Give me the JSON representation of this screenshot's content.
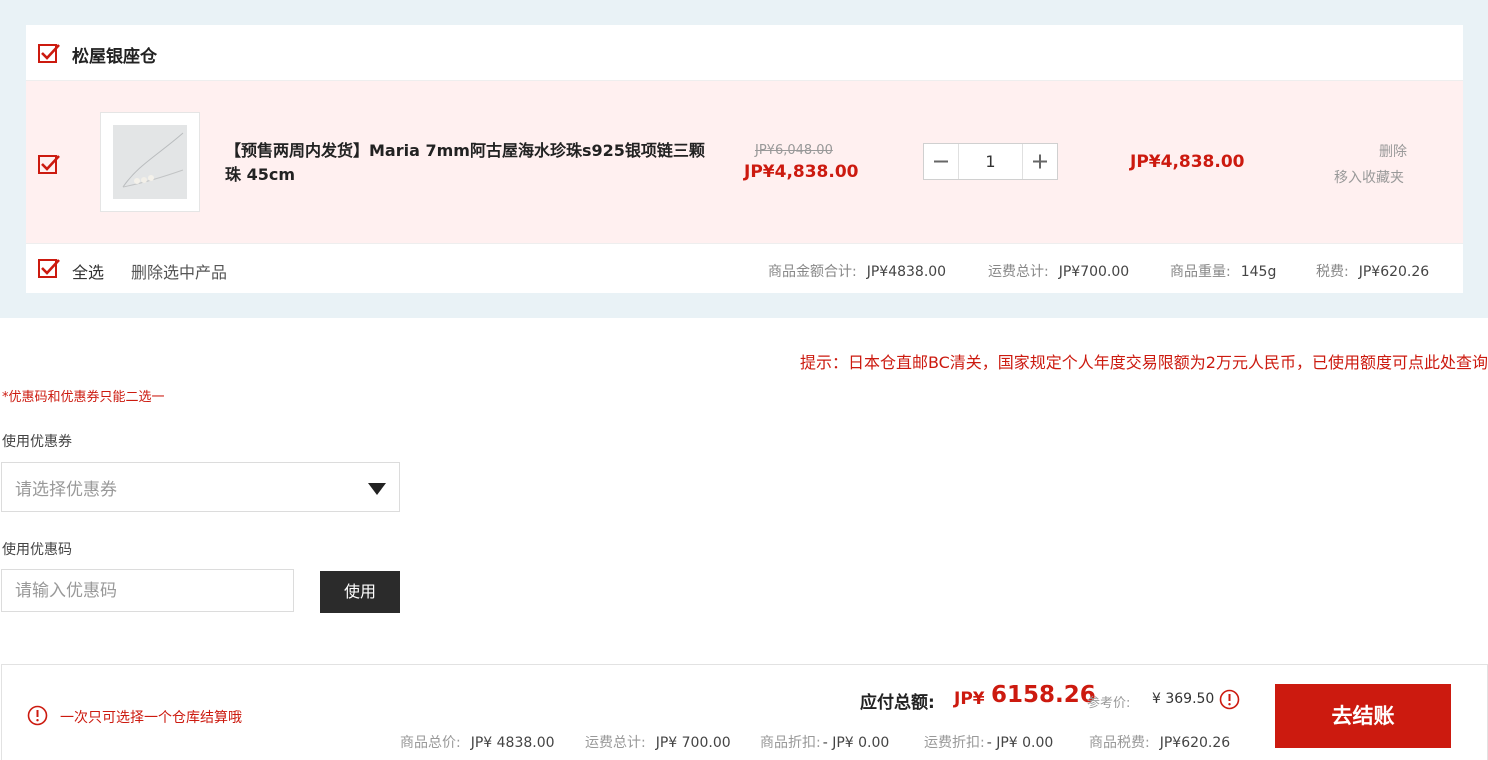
{
  "cart": {
    "warehouse_name": "松屋银座仓",
    "item": {
      "title": "【预售两周内发货】Maria 7mm阿古屋海水珍珠s925银项链三颗珠 45cm",
      "original_price": "JP¥6,048.00",
      "sale_price": "JP¥4,838.00",
      "quantity": "1",
      "subtotal": "JP¥4,838.00",
      "delete_label": "删除",
      "favorite_label": "移入收藏夹"
    },
    "footer": {
      "select_all": "全选",
      "delete_selected": "删除选中产品",
      "goods_total_label": "商品金额合计:",
      "goods_total_value": "JP¥4838.00",
      "shipping_label": "运费总计:",
      "shipping_value": "JP¥700.00",
      "weight_label": "商品重量:",
      "weight_value": "145g",
      "tax_label": "税费:",
      "tax_value": "JP¥620.26"
    }
  },
  "notice": "提示：日本仓直邮BC清关，国家规定个人年度交易限额为2万元人民币，已使用额度可点此处查询",
  "coupon": {
    "note": "*优惠码和优惠券只能二选一",
    "coupon_label": "使用优惠券",
    "coupon_placeholder": "请选择优惠券",
    "code_label": "使用优惠码",
    "code_placeholder": "请输入优惠码",
    "use_button": "使用"
  },
  "checkout": {
    "warning": "一次只可选择一个仓库结算哦",
    "payable_label": "应付总额:",
    "payable_currency": "JP¥",
    "payable_amount": "6158.26",
    "reference_label": "参考价:",
    "reference_value": "¥ 369.50",
    "breakdown": [
      {
        "label": "商品总价:",
        "value": "JP¥ 4838.00"
      },
      {
        "label": "运费总计:",
        "value": "JP¥ 700.00"
      },
      {
        "label": "商品折扣:",
        "value": "- JP¥ 0.00"
      },
      {
        "label": "运费折扣:",
        "value": "- JP¥ 0.00"
      },
      {
        "label": "商品税费:",
        "value": "JP¥620.26"
      }
    ],
    "button": "去结账"
  },
  "colors": {
    "accent": "#cc1a0f",
    "panel_bg": "#e9f2f6",
    "item_bg": "#fff0f0"
  }
}
